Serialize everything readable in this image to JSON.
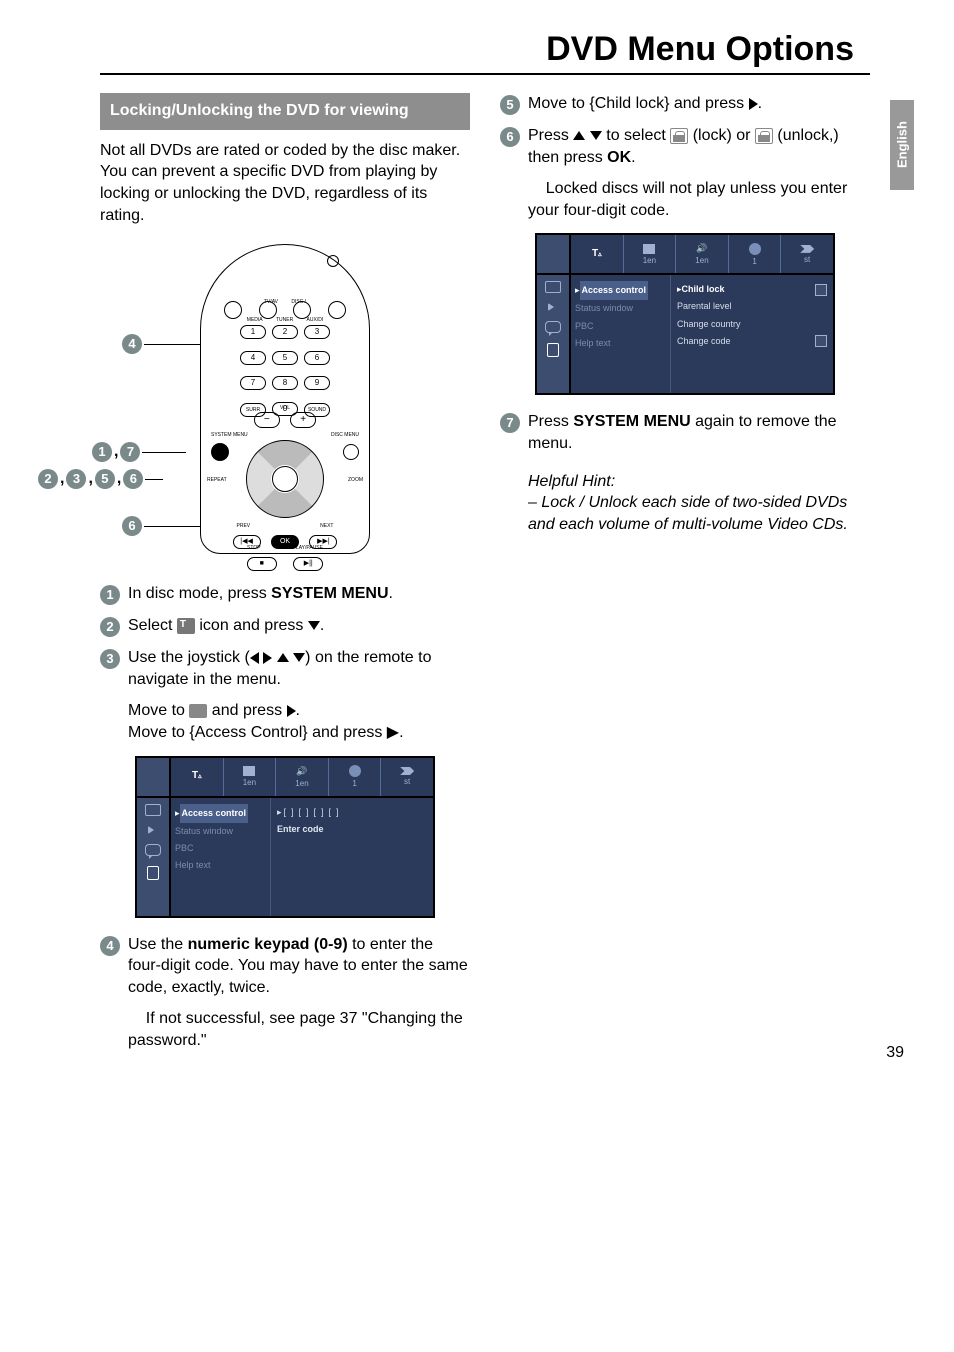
{
  "title": "DVD Menu Options",
  "sideTab": "English",
  "pageNumber": "39",
  "section": {
    "header": "Locking/Unlocking the DVD for viewing",
    "intro": "Not all DVDs are rated or coded by the disc maker.  You can prevent a specific DVD from playing by locking or unlocking the DVD, regardless of its rating."
  },
  "remote": {
    "labels": {
      "tvav": "TV/AV",
      "disc": "DISC /",
      "media": "MEDIA",
      "tuner": "TUNER",
      "aux": "AUX/DI"
    },
    "keys": [
      "1",
      "2",
      "3",
      "4",
      "5",
      "6",
      "7",
      "8",
      "9",
      "0"
    ],
    "surr": "SURR",
    "sound": "SOUND",
    "vol": "VOL",
    "systemMenu": "SYSTEM MENU",
    "discMenu": "DISC MENU",
    "repeat": "REPEAT",
    "zoom": "ZOOM",
    "prev": "PREV",
    "next": "NEXT",
    "ok": "OK",
    "stop": "STOP",
    "playpause": "PLAY/PAUSE",
    "stopSym": "■",
    "playSym": "▶||",
    "nextSym": "▶▶|",
    "prevSym": "|◀◀"
  },
  "callouts": {
    "c4": "4",
    "c17": {
      "a": "1",
      "b": "7"
    },
    "c2356": {
      "a": "2",
      "b": "3",
      "c": "5",
      "d": "6"
    },
    "c6": "6"
  },
  "steps": {
    "s1": {
      "n": "1",
      "pre": "In disc mode, press ",
      "bold": "SYSTEM MENU",
      "post": "."
    },
    "s2": {
      "n": "2",
      "pre": "Select ",
      "post": " icon and press ",
      "sym": "▼",
      "end": "."
    },
    "s3": {
      "n": "3",
      "pre": "Use the joystick (",
      "syms": "◀ ▶ ▲ ▼",
      "post": ") on the remote to navigate in the menu."
    },
    "s3a": {
      "pre": "Move to ",
      "post": " and press ",
      "sym": "▶",
      "end": "."
    },
    "s3b": "Move to {Access Control} and press ▶.",
    "s4": {
      "n": "4",
      "pre": "Use the ",
      "bold": "numeric keypad (0-9)",
      "post": " to enter the four-digit code.  You may have to enter the same code, exactly, twice."
    },
    "s4a": "If not successful, see page 37 \"Changing the password.\"",
    "s5": {
      "n": "5",
      "text": "Move to {Child lock} and press ▶."
    },
    "s6": {
      "n": "6",
      "pre": "Press ▲ ▼ to select ",
      "mid": " (lock) or ",
      "post": " (unlock,) then press ",
      "bold": "OK",
      "end": "."
    },
    "s6a": "Locked discs will not play unless you enter your four-digit code.",
    "s7": {
      "n": "7",
      "pre": "Press ",
      "bold": "SYSTEM MENU",
      "post": " again to remove the menu."
    }
  },
  "osd1": {
    "tabs": [
      "1en",
      "1en",
      "1",
      "st"
    ],
    "menu": [
      "Access control",
      "Status window",
      "PBC",
      "Help text"
    ],
    "codeDisplay": "[  ][  ][  ][  ]",
    "enter": "Enter code"
  },
  "osd2": {
    "tabs": [
      "1en",
      "1en",
      "1",
      "st"
    ],
    "menu": [
      "Access control",
      "Status window",
      "PBC",
      "Help text"
    ],
    "detail": [
      "Child lock",
      "Parental level",
      "Change country",
      "Change code"
    ]
  },
  "hint": {
    "title": "Helpful Hint:",
    "body": "– Lock / Unlock each side of two-sided DVDs and each volume of multi-volume Video CDs."
  }
}
